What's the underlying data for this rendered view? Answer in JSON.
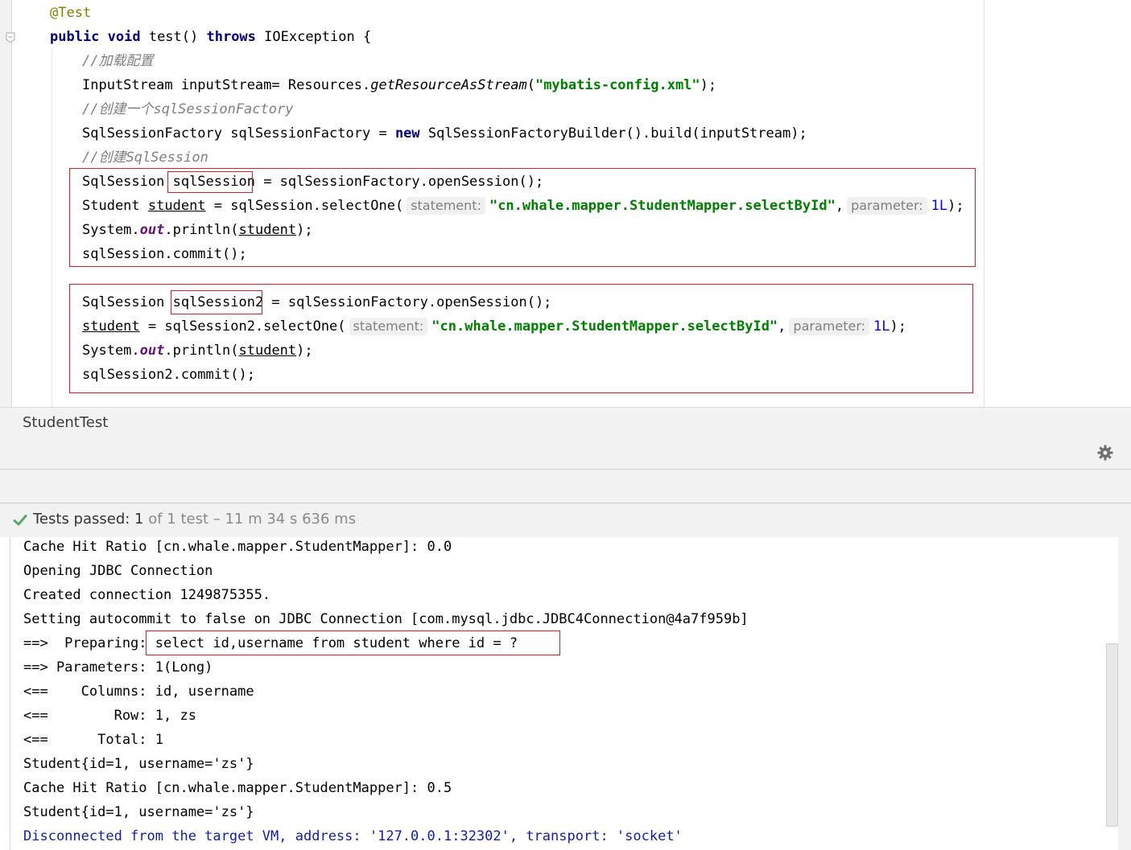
{
  "editor": {
    "lines": [
      {
        "parts": [
          {
            "t": "@Test",
            "c": "ann"
          }
        ]
      },
      {
        "parts": [
          {
            "t": "public void ",
            "c": "kw"
          },
          {
            "t": "test() "
          },
          {
            "t": "throws ",
            "c": "kw"
          },
          {
            "t": "IOException {"
          }
        ]
      },
      {
        "parts": [
          {
            "t": "//加载配置",
            "c": "cmt"
          }
        ]
      },
      {
        "parts": [
          {
            "t": "InputStream inputStream= Resources."
          },
          {
            "t": "getResourceAsStream",
            "c": "static-m"
          },
          {
            "t": "("
          },
          {
            "t": "\"mybatis-config.xml\"",
            "c": "str"
          },
          {
            "t": ");"
          }
        ]
      },
      {
        "parts": [
          {
            "t": "//创建一个sqlSessionFactory",
            "c": "cmt"
          }
        ]
      },
      {
        "parts": [
          {
            "t": "SqlSessionFactory sqlSessionFactory = "
          },
          {
            "t": "new ",
            "c": "kw"
          },
          {
            "t": "SqlSessionFactoryBuilder().build(inputStream);"
          }
        ]
      },
      {
        "parts": [
          {
            "t": "//创建SqlSession",
            "c": "cmt"
          }
        ]
      },
      {
        "parts": [
          {
            "t": "SqlSession "
          },
          {
            "t": "sqlSession"
          },
          {
            "t": " = sqlSessionFactory.openSession();"
          }
        ]
      },
      {
        "parts": [
          {
            "t": "Student "
          },
          {
            "t": "student",
            "c": "ul"
          },
          {
            "t": " = sqlSession.selectOne("
          },
          {
            "t": "statement:",
            "c": "hint"
          },
          {
            "t": "\"cn.whale.mapper.StudentMapper.selectById\"",
            "c": "str"
          },
          {
            "t": ","
          },
          {
            "t": "parameter:",
            "c": "hint"
          },
          {
            "t": "1L",
            "c": "num"
          },
          {
            "t": ");"
          }
        ]
      },
      {
        "parts": [
          {
            "t": "System."
          },
          {
            "t": "out",
            "c": "field"
          },
          {
            "t": ".println("
          },
          {
            "t": "student",
            "c": "ul"
          },
          {
            "t": ");"
          }
        ]
      },
      {
        "parts": [
          {
            "t": "sqlSession.commit();"
          }
        ]
      },
      {
        "parts": []
      },
      {
        "parts": [
          {
            "t": "SqlSession "
          },
          {
            "t": "sqlSession2"
          },
          {
            "t": " = sqlSessionFactory.openSession();"
          }
        ]
      },
      {
        "parts": [
          {
            "t": "student",
            "c": "ul"
          },
          {
            "t": " = sqlSession2.selectOne("
          },
          {
            "t": "statement:",
            "c": "hint"
          },
          {
            "t": "\"cn.whale.mapper.StudentMapper.selectById\"",
            "c": "str"
          },
          {
            "t": ","
          },
          {
            "t": "parameter:",
            "c": "hint"
          },
          {
            "t": "1L",
            "c": "num"
          },
          {
            "t": ");"
          }
        ]
      },
      {
        "parts": [
          {
            "t": "System."
          },
          {
            "t": "out",
            "c": "field"
          },
          {
            "t": ".println("
          },
          {
            "t": "student",
            "c": "ul"
          },
          {
            "t": ");"
          }
        ]
      },
      {
        "parts": [
          {
            "t": "sqlSession2.commit();"
          }
        ]
      }
    ]
  },
  "run_panel": {
    "tab_title": "StudentTest",
    "status": {
      "passed_label": "Tests passed: ",
      "passed_count": "1",
      "rest": " of 1 test – 11 m 34 s 636 ms"
    }
  },
  "console": {
    "lines": [
      {
        "t": "Cache Hit Ratio [cn.whale.mapper.StudentMapper]: 0.0"
      },
      {
        "t": "Opening JDBC Connection"
      },
      {
        "t": "Created connection 1249875355."
      },
      {
        "t": "Setting autocommit to false on JDBC Connection [com.mysql.jdbc.JDBC4Connection@4a7f959b]"
      },
      {
        "t": "==>  Preparing: select id,username from student where id = ?"
      },
      {
        "t": "==> Parameters: 1(Long)"
      },
      {
        "t": "<==    Columns: id, username"
      },
      {
        "t": "<==        Row: 1, zs"
      },
      {
        "t": "<==      Total: 1"
      },
      {
        "t": "Student{id=1, username='zs'}"
      },
      {
        "t": "Cache Hit Ratio [cn.whale.mapper.StudentMapper]: 0.5"
      },
      {
        "t": "Student{id=1, username='zs'}"
      },
      {
        "t": "Disconnected from the target VM, address: '127.0.0.1:32302', transport: 'socket'",
        "c": "con-blue"
      }
    ]
  },
  "colors": {
    "highlight_box": "#d5202a",
    "pass_check": "#59a869"
  }
}
